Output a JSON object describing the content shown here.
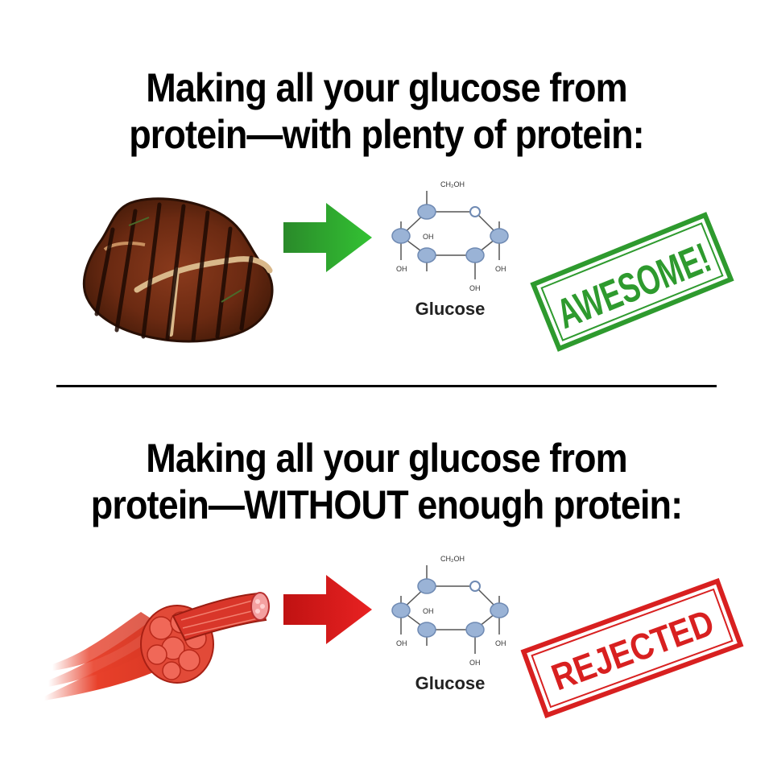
{
  "top_panel": {
    "headline_line1": "Making all your glucose from",
    "headline_line2": "protein—with plenty of protein:",
    "source_icon": "steak-icon",
    "arrow_color": "#2aa82a",
    "molecule": {
      "label": "Glucose",
      "ch2oh": "CH₂OH",
      "oh_labels": [
        "OH",
        "OH",
        "OH",
        "OH"
      ]
    },
    "stamp": {
      "text": "AWESOME!",
      "color": "#2e9a2e"
    }
  },
  "bottom_panel": {
    "headline_line1": "Making all your glucose from",
    "headline_line2": "protein—WITHOUT enough protein:",
    "source_icon": "muscle-fiber-icon",
    "arrow_color": "#d01818",
    "molecule": {
      "label": "Glucose",
      "ch2oh": "CH₂OH",
      "oh_labels": [
        "OH",
        "OH",
        "OH",
        "OH"
      ]
    },
    "stamp": {
      "text": "REJECTED",
      "color": "#d82020"
    }
  }
}
